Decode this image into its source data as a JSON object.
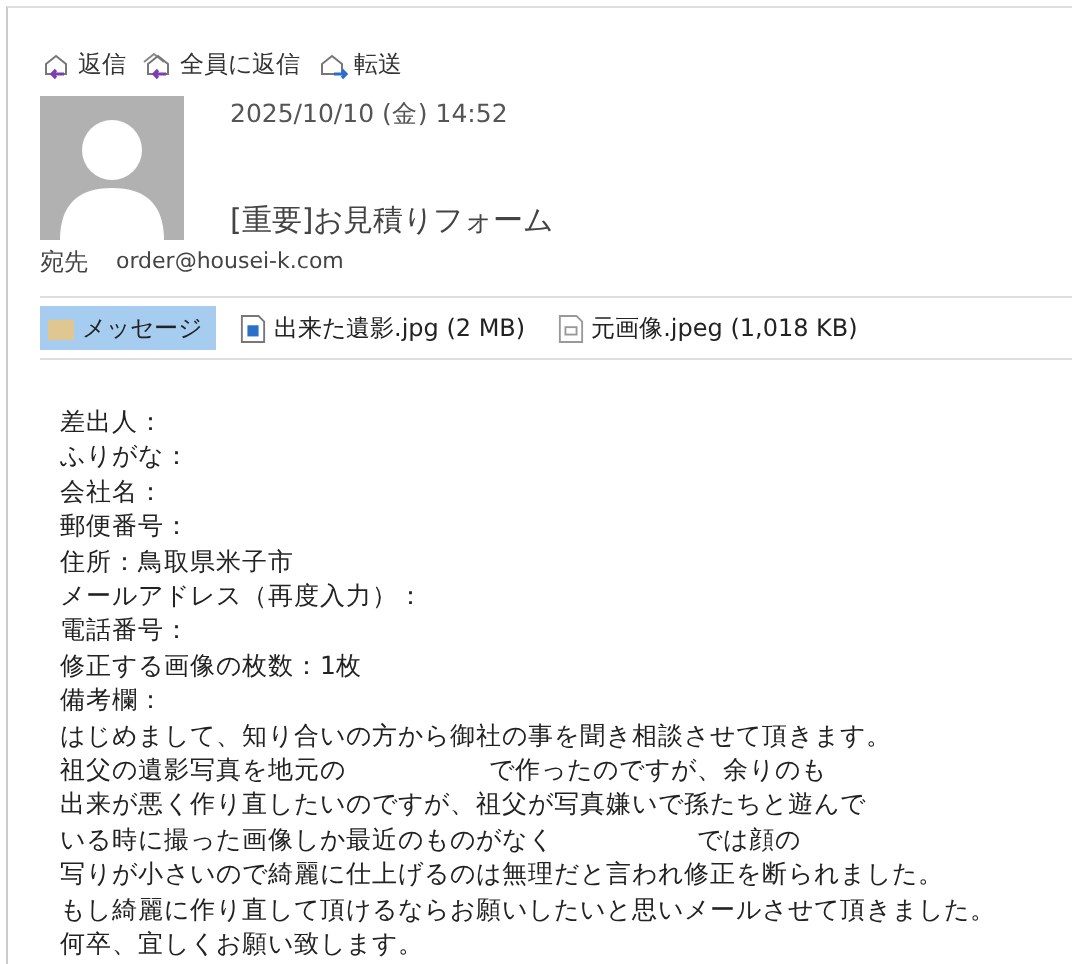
{
  "toolbar": [
    {
      "kind": "reply",
      "label": "返信"
    },
    {
      "kind": "reply_all",
      "label": "全員に返信"
    },
    {
      "kind": "forward",
      "label": "転送"
    }
  ],
  "header": {
    "date": "2025/10/10 (金) 14:52",
    "subject": "[重要]お見積りフォーム",
    "to_label": "宛先",
    "to": "order@housei-k.com"
  },
  "attachments": [
    {
      "kind": "message",
      "label": "メッセージ",
      "selected": true
    },
    {
      "kind": "image",
      "label": "出来た遺影.jpg (2 MB)",
      "selected": false
    },
    {
      "kind": "file",
      "label": "元画像.jpeg (1,018 KB)",
      "selected": false
    }
  ],
  "body": [
    "差出人：",
    "ふりがな：",
    "会社名：",
    "郵便番号：",
    "住所：鳥取県米子市",
    "メールアドレス（再度入力）：",
    "電話番号：",
    "修正する画像の枚数：1枚",
    "備考欄：",
    "はじめまして、知り合いの方から御社の事を聞き相談させて頂きます。",
    "祖父の遺影写真を地元の                  で作ったのですが、余りのも",
    "出来が悪く作り直したいのですが、祖父が写真嫌いで孫たちと遊んで",
    "いる時に撮った画像しか最近のものがなく                  では顔の",
    "写りが小さいので綺麗に仕上げるのは無理だと言われ修正を断られました。",
    "もし綺麗に作り直して頂けるならお願いしたいと思いメールさせて頂きました。",
    "何卒、宜しくお願い致します。"
  ]
}
